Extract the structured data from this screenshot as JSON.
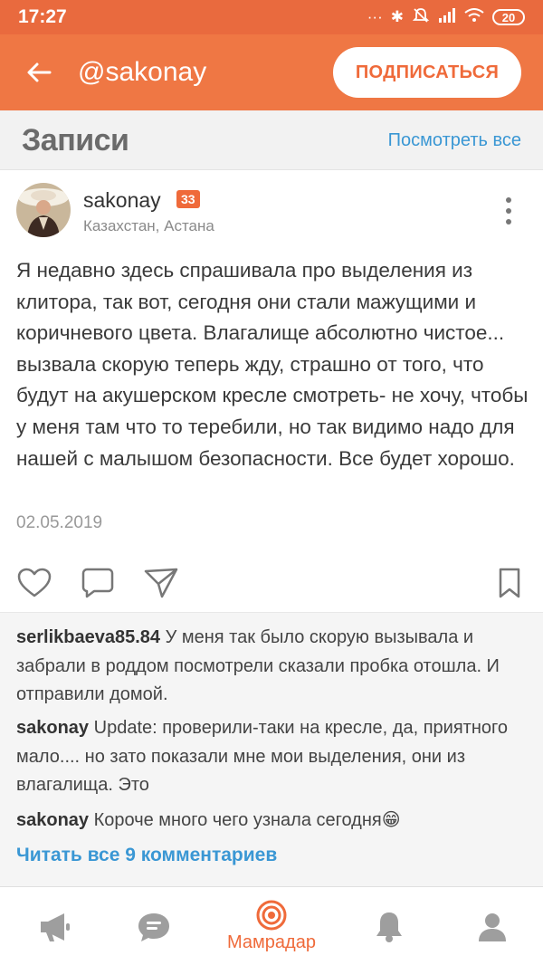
{
  "status_bar": {
    "time": "17:27",
    "battery": "20"
  },
  "app_bar": {
    "title": "@sakonay",
    "subscribe_label": "ПОДПИСАТЬСЯ"
  },
  "section": {
    "title": "Записи",
    "see_all_label": "Посмотреть все"
  },
  "post": {
    "author": "sakonay",
    "level": "33",
    "location": "Казахстан, Астана",
    "text": "Я недавно здесь спрашивала про выделения из клитора, так вот, сегодня они стали мажущими и коричневого цвета. Влагалище абсолютно чистое... вызвала скорую теперь жду, страшно от того, что будут на акушерском кресле смотреть- не хочу, чтобы у меня там что то теребили, но так видимо надо для нашей с малышом безопасности. Все будет хорошо.",
    "date": "02.05.2019"
  },
  "comments": [
    {
      "author": "serlikbaeva85.84",
      "text": "У меня так было скорую вызывала и забрали в роддом посмотрели  сказали пробка отошла. И отправили домой."
    },
    {
      "author": "sakonay",
      "text": "Update: проверили-таки на кресле, да, приятного мало.... но зато показали мне мои выделения, они из влагалища. Это"
    },
    {
      "author": "sakonay",
      "text": "Короче много чего узнала сегодня😁"
    }
  ],
  "read_all_label": "Читать все 9 комментариев",
  "bottom_nav": {
    "items": [
      {
        "icon": "megaphone-icon",
        "label": ""
      },
      {
        "icon": "chat-icon",
        "label": ""
      },
      {
        "icon": "target-icon",
        "label": "Мамрадар",
        "active": true
      },
      {
        "icon": "bell-icon",
        "label": ""
      },
      {
        "icon": "profile-icon",
        "label": ""
      }
    ]
  },
  "colors": {
    "accent": "#ef7744",
    "status_bar": "#e96a3e",
    "link": "#3a97d4",
    "nav_inactive": "#9e9e9e"
  }
}
